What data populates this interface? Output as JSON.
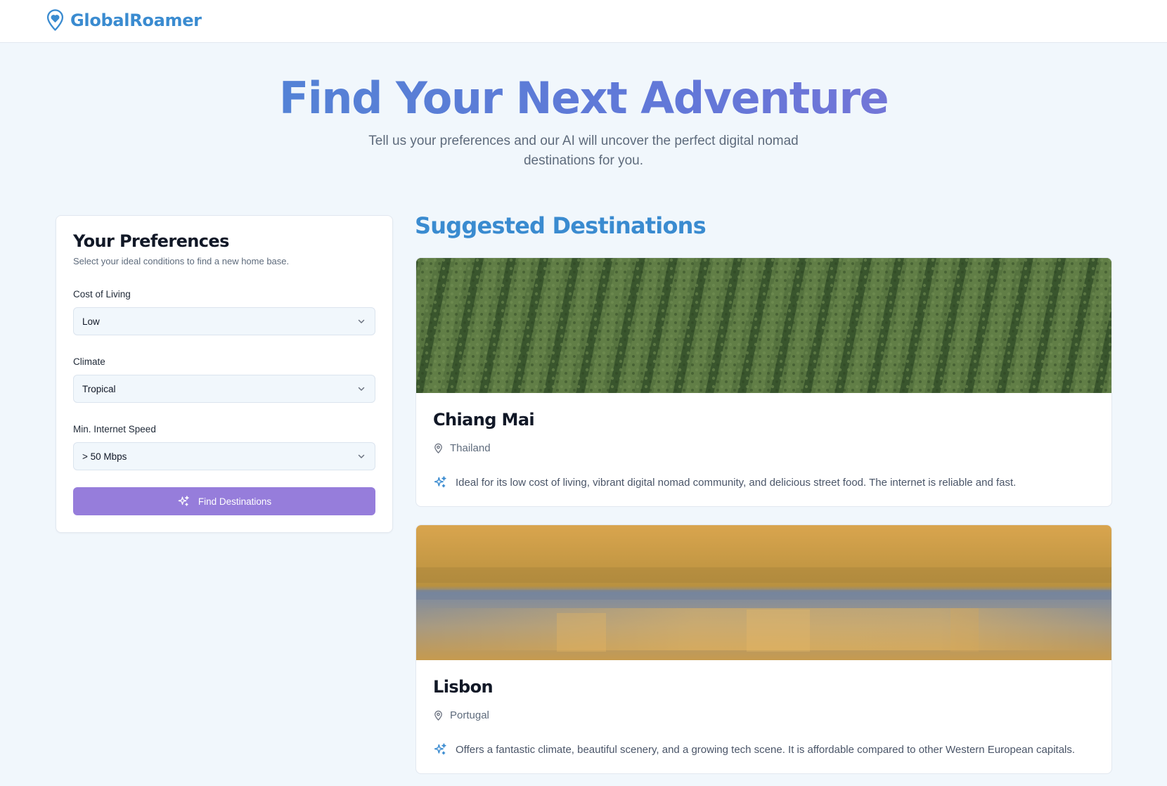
{
  "header": {
    "brand_name": "GlobalRoamer",
    "brand_icon": "map-pin-heart-icon",
    "brand_color": "#3a8bd0"
  },
  "hero": {
    "title": "Find Your Next Adventure",
    "subtitle": "Tell us your preferences and our AI will uncover the perfect digital nomad destinations for you."
  },
  "preferences": {
    "title": "Your Preferences",
    "subtitle": "Select your ideal conditions to find a new home base.",
    "fields": [
      {
        "label": "Cost of Living",
        "value": "Low",
        "icon": "chevron-down-icon"
      },
      {
        "label": "Climate",
        "value": "Tropical",
        "icon": "chevron-down-icon"
      },
      {
        "label": "Min. Internet Speed",
        "value": "> 50 Mbps",
        "icon": "chevron-down-icon"
      }
    ],
    "button_label": "Find Destinations",
    "button_icon": "sparkles-icon",
    "button_color": "#967ddb"
  },
  "results": {
    "title": "Suggested Destinations",
    "destinations": [
      {
        "name": "Chiang Mai",
        "country": "Thailand",
        "description": "Ideal for its low cost of living, vibrant digital nomad community, and delicious street food. The internet is reliable and fast.",
        "image": "tea-plantation-rows",
        "icon_location": "map-pin-icon",
        "icon_desc": "sparkles-icon"
      },
      {
        "name": "Lisbon",
        "country": "Portugal",
        "description": "Offers a fantastic climate, beautiful scenery, and a growing tech scene. It is affordable compared to other Western European capitals.",
        "image": "golden-river-reflection",
        "icon_location": "map-pin-icon",
        "icon_desc": "sparkles-icon"
      }
    ]
  }
}
